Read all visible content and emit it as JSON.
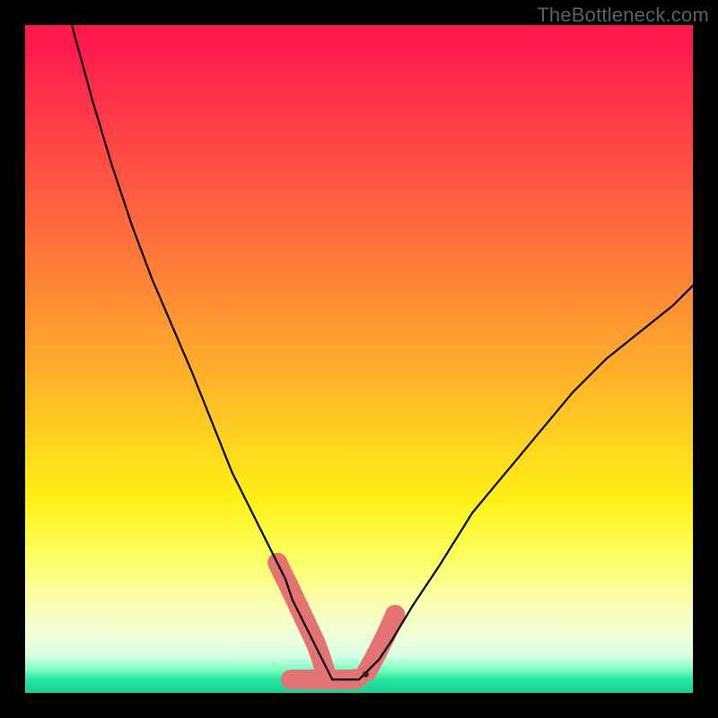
{
  "watermark": "TheBottleneck.com",
  "chart_data": {
    "type": "line",
    "title": "",
    "xlabel": "",
    "ylabel": "",
    "xlim": [
      0,
      100
    ],
    "ylim": [
      0,
      100
    ],
    "grid": false,
    "legend": false,
    "series": [
      {
        "name": "left-curve",
        "stroke": "#000000",
        "x": [
          7,
          10,
          13,
          16,
          19,
          22,
          25,
          27,
          29,
          31,
          33,
          35,
          36,
          37,
          38,
          39,
          40,
          41,
          42,
          43,
          44,
          45,
          46
        ],
        "y": [
          100,
          89,
          79,
          70,
          62,
          55,
          48,
          43,
          38,
          33,
          29,
          25,
          23,
          21,
          19,
          17,
          14,
          12,
          10,
          8,
          6,
          4,
          2
        ]
      },
      {
        "name": "right-curve",
        "stroke": "#000000",
        "x": [
          46,
          47,
          48,
          49,
          50,
          51,
          52,
          53,
          55,
          58,
          62,
          67,
          72,
          77,
          82,
          87,
          92,
          97,
          100
        ],
        "y": [
          2,
          2,
          2,
          2,
          2,
          3,
          4,
          5,
          8,
          13,
          19,
          27,
          33,
          39,
          45,
          50,
          54,
          58,
          61
        ]
      },
      {
        "name": "left-markers",
        "stroke": "#e57373",
        "marker": true,
        "x": [
          37.8,
          38.6,
          39.4,
          40.2,
          41.0,
          41.8,
          42.6,
          43.4,
          44.2,
          45.0
        ],
        "y": [
          19.5,
          17.8,
          16.2,
          14.5,
          12.8,
          11.1,
          9.4,
          7.7,
          5.6,
          3.0
        ]
      },
      {
        "name": "bottom-markers",
        "stroke": "#e57373",
        "marker": true,
        "x": [
          39.8,
          40.9,
          42.0,
          43.1,
          44.2,
          45.3,
          46.4,
          47.5,
          48.6,
          49.7
        ],
        "y": [
          2.0,
          2.0,
          2.0,
          2.0,
          2.0,
          2.0,
          2.0,
          2.0,
          2.0,
          2.1
        ]
      },
      {
        "name": "right-markers",
        "stroke": "#e57373",
        "marker": true,
        "x": [
          51.2,
          51.9,
          52.6,
          53.3,
          54.0,
          54.7,
          55.4
        ],
        "y": [
          3.2,
          4.5,
          5.8,
          7.2,
          8.6,
          10.1,
          11.7
        ]
      }
    ],
    "background_gradient": {
      "type": "vertical",
      "stops": [
        {
          "pos": 0.0,
          "color": "#ff1a4d"
        },
        {
          "pos": 0.3,
          "color": "#ff6a3d"
        },
        {
          "pos": 0.62,
          "color": "#ffd21f"
        },
        {
          "pos": 0.86,
          "color": "#f8ffa8"
        },
        {
          "pos": 0.96,
          "color": "#7cffc2"
        },
        {
          "pos": 1.0,
          "color": "#15d492"
        }
      ]
    }
  }
}
